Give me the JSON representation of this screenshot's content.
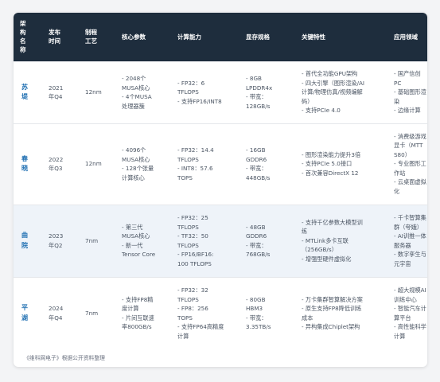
{
  "headers": {
    "name": [
      "架",
      "构",
      "名",
      "称"
    ],
    "release": [
      "发布",
      "时间"
    ],
    "process": [
      "制程",
      "工艺"
    ],
    "core": "核心参数",
    "compute": "计算能力",
    "memory": "显存规格",
    "features": "关键特性",
    "apps": "应用领域"
  },
  "rows": [
    {
      "name": [
        "苏",
        "堤"
      ],
      "release": [
        "2021",
        "年Q4"
      ],
      "process": "12nm",
      "core": [
        "- 2048个",
        "MUSA核心",
        "- 4个MUSA",
        "处理器簇"
      ],
      "compute": [
        "- FP32：6",
        "TFLOPS",
        "- 支持FP16/INT8"
      ],
      "memory": [
        "- 8GB",
        "LPDDR4x",
        "- 带宽：",
        "128GB/s"
      ],
      "features": [
        "- 首代全功能GPU架构",
        "- 四大引擎（图形渲染/AI",
        "计算/物理仿真/视频编解",
        "码）",
        "- 支持PCIe 4.0"
      ],
      "apps": [
        "- 国产信创PC",
        "- 基础图形渲",
        "染",
        "- 边缘计算"
      ]
    },
    {
      "name": [
        "春",
        "晓"
      ],
      "release": [
        "2022",
        "年Q3"
      ],
      "process": "12nm",
      "core": [
        "- 4096个",
        "MUSA核心",
        "- 128个张量",
        "计算核心"
      ],
      "compute": [
        "- FP32：14.4",
        "TFLOPS",
        "- INT8：57.6",
        "TOPS"
      ],
      "memory": [
        "- 16GB",
        "GDDR6",
        "- 带宽：",
        "448GB/s"
      ],
      "features": [
        "- 图形渲染能力提升3倍",
        "- 支持PCIe 5.0接口",
        "- 首次兼容DirectX 12"
      ],
      "apps": [
        "- 消费级游戏",
        "显卡（MTT",
        "S80）",
        "- 专业图形工",
        "作站",
        "- 云桌面虚拟",
        "化"
      ]
    },
    {
      "name": [
        "曲",
        "院"
      ],
      "release": [
        "2023",
        "年Q2"
      ],
      "process": "7nm",
      "core": [
        "- 第三代",
        "MUSA核心",
        "- 新一代",
        "Tensor Core"
      ],
      "compute": [
        "- FP32：25",
        "TFLOPS",
        "- TF32：50",
        "TFLOPS",
        "- FP16/BF16:",
        "100 TFLOPS"
      ],
      "memory": [
        "- 48GB",
        "GDDR6",
        "- 带宽：",
        "768GB/s"
      ],
      "features": [
        "- 支持千亿参数大模型训",
        "练",
        "- MTLink多卡互联",
        "（256GB/s）",
        "- 增强型硬件虚拟化"
      ],
      "apps": [
        "- 千卡智算集",
        "群（夸娥）",
        "- AI训推一体",
        "服务器",
        "- 数字孪生与",
        "元宇宙"
      ]
    },
    {
      "name": [
        "平",
        "湖"
      ],
      "release": [
        "2024",
        "年Q4"
      ],
      "process": "7nm",
      "core": [
        "- 支持FP8精",
        "度计算",
        "- 片间互联速",
        "率800GB/s"
      ],
      "compute": [
        "- FP32：32",
        "TFLOPS",
        "- FP8：256",
        "TOPS",
        "- 支持FP64高精度",
        "计算"
      ],
      "memory": [
        "- 80GB",
        "HBM3",
        "- 带宽：",
        "3.35TB/s"
      ],
      "features": [
        "- 万卡集群智算解决方案",
        "- 原生支持FP8降低训练",
        "成本",
        "- 异构集成Chiplet架构"
      ],
      "apps": [
        "- 超大规模AI",
        "训练中心",
        "- 智能汽车计",
        "算平台",
        "- 高性能科学",
        "计算"
      ]
    }
  ],
  "footer": "《维科网电子》根据公开资料整理"
}
